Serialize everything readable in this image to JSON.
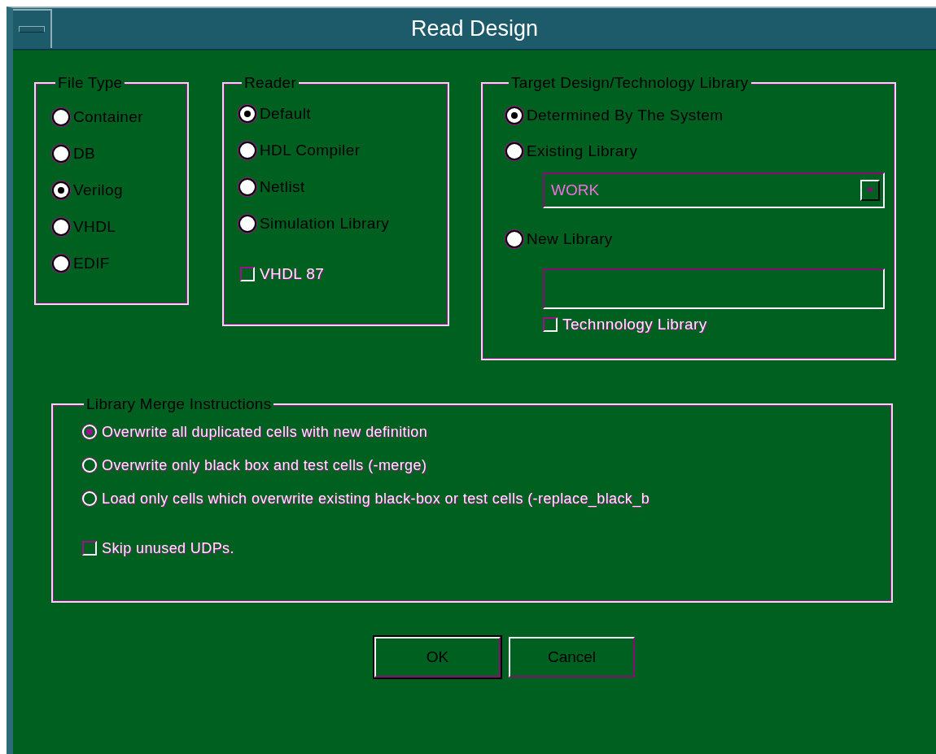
{
  "window": {
    "title": "Read Design"
  },
  "file_type": {
    "legend": "File Type",
    "options": [
      {
        "label": "Container",
        "selected": false
      },
      {
        "label": "DB",
        "selected": false
      },
      {
        "label": "Verilog",
        "selected": true
      },
      {
        "label": "VHDL",
        "selected": false
      },
      {
        "label": "EDIF",
        "selected": false
      }
    ]
  },
  "reader": {
    "legend": "Reader",
    "options": [
      {
        "label": "Default",
        "selected": true
      },
      {
        "label": "HDL Compiler",
        "selected": false
      },
      {
        "label": "Netlist",
        "selected": false
      },
      {
        "label": "Simulation Library",
        "selected": false
      }
    ],
    "checkbox": {
      "label": "VHDL 87",
      "checked": false,
      "disabled": true
    }
  },
  "target": {
    "legend": "Target Design/Technology Library",
    "options": [
      {
        "label": "Determined By The System",
        "selected": true,
        "kind": "plain"
      },
      {
        "label": "Existing Library",
        "selected": false,
        "kind": "dropdown",
        "value": "WORK",
        "disabled": true
      },
      {
        "label": "New Library",
        "selected": false,
        "kind": "field",
        "disabled": true
      }
    ],
    "checkbox": {
      "label": "Technnology Library",
      "checked": false,
      "disabled": true
    }
  },
  "merge": {
    "legend": "Library Merge Instructions",
    "options": [
      {
        "label": "Overwrite all duplicated cells with new definition",
        "selected": true,
        "disabled": true
      },
      {
        "label": "Overwrite only black box and test cells (-merge)",
        "selected": false,
        "disabled": true
      },
      {
        "label": "Load only cells which overwrite existing black-box or test cells (-replace_black_b",
        "selected": false,
        "disabled": true
      }
    ],
    "checkbox": {
      "label": "Skip unused UDPs.",
      "checked": false,
      "disabled": true
    }
  },
  "buttons": [
    {
      "label": "OK",
      "default": true
    },
    {
      "label": "Cancel",
      "default": false
    }
  ]
}
